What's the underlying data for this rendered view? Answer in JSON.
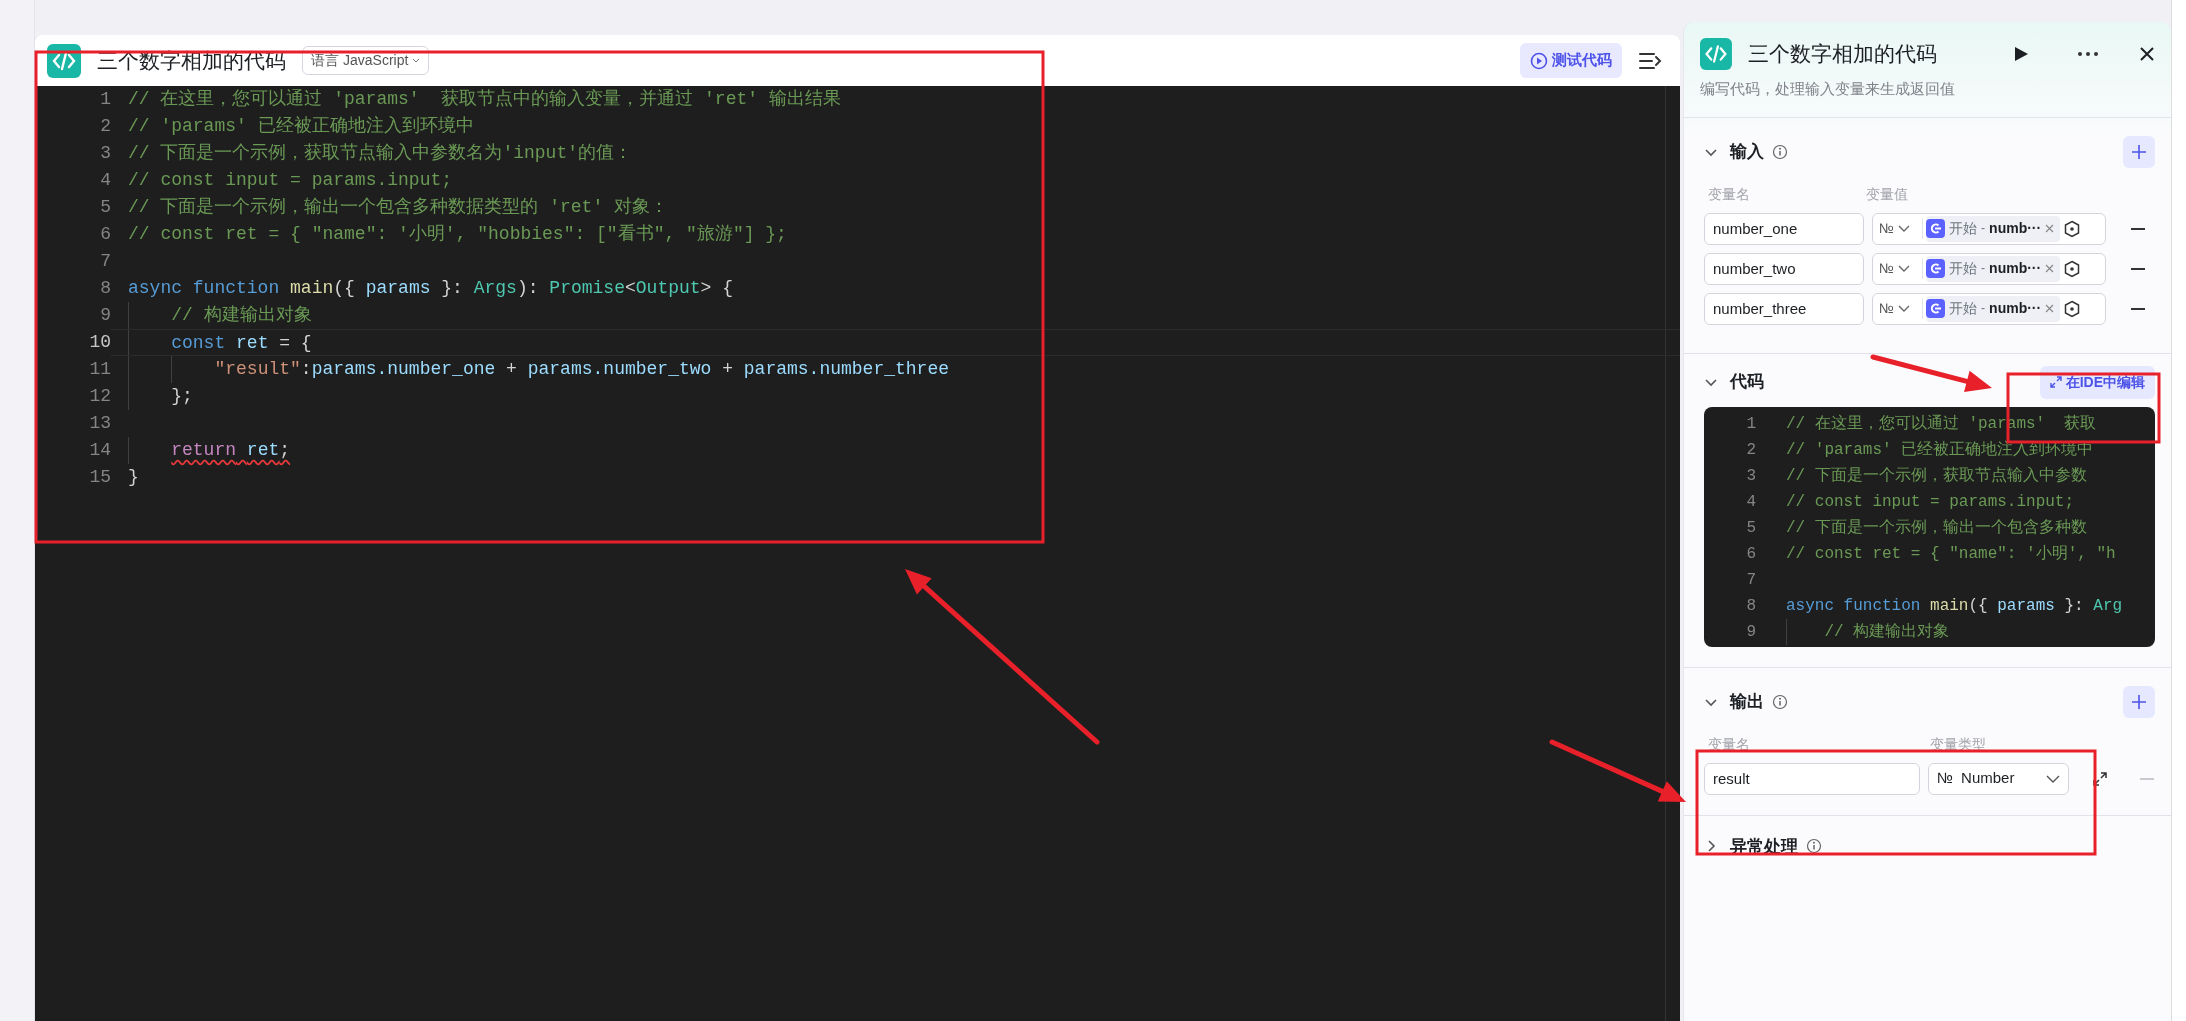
{
  "editor": {
    "title": "三个数字相加的代码",
    "language_label": "语言",
    "language": "JavaScript",
    "test_button": "测试代码",
    "lines": [
      {
        "number": "1",
        "current": false,
        "tokens": [
          {
            "kind": "comment",
            "text": "// 在这里，您可以通过 'params'  获取节点中的输入变量，并通过 'ret' 输出结果"
          }
        ]
      },
      {
        "number": "2",
        "current": false,
        "tokens": [
          {
            "kind": "comment",
            "text": "// 'params' 已经被正确地注入到环境中"
          }
        ]
      },
      {
        "number": "3",
        "current": false,
        "tokens": [
          {
            "kind": "comment",
            "text": "// 下面是一个示例，获取节点输入中参数名为'input'的值："
          }
        ]
      },
      {
        "number": "4",
        "current": false,
        "tokens": [
          {
            "kind": "comment",
            "text": "// const input = params.input;"
          }
        ]
      },
      {
        "number": "5",
        "current": false,
        "tokens": [
          {
            "kind": "comment",
            "text": "// 下面是一个示例，输出一个包含多种数据类型的 'ret' 对象："
          }
        ]
      },
      {
        "number": "6",
        "current": false,
        "tokens": [
          {
            "kind": "comment",
            "text": "// const ret = { \"name\": '小明', \"hobbies\": [\"看书\", \"旅游\"] };"
          }
        ]
      },
      {
        "number": "7",
        "current": false
      },
      {
        "number": "8",
        "current": false,
        "tokens": [
          {
            "kind": "keyword",
            "text": "async function "
          },
          {
            "kind": "function",
            "text": "main"
          },
          {
            "kind": "plain",
            "text": "({ "
          },
          {
            "kind": "variable",
            "text": "params"
          },
          {
            "kind": "plain",
            "text": " }: "
          },
          {
            "kind": "type",
            "text": "Args"
          },
          {
            "kind": "plain",
            "text": "): "
          },
          {
            "kind": "type",
            "text": "Promise"
          },
          {
            "kind": "plain",
            "text": "<"
          },
          {
            "kind": "type",
            "text": "Output"
          },
          {
            "kind": "plain",
            "text": "> {"
          }
        ]
      },
      {
        "number": "9",
        "current": false,
        "tokens": [
          {
            "kind": "comment",
            "text": "    // 构建输出对象"
          }
        ]
      },
      {
        "number": "10",
        "current": true,
        "tokens": [
          {
            "kind": "keyword",
            "text": "    const "
          },
          {
            "kind": "variable",
            "text": "ret"
          },
          {
            "kind": "plain",
            "text": " = {"
          }
        ]
      },
      {
        "number": "11",
        "current": false,
        "tokens": [
          {
            "kind": "string",
            "text": "        \"result\""
          },
          {
            "kind": "plain",
            "text": ":"
          },
          {
            "kind": "variable",
            "text": "params.number_one"
          },
          {
            "kind": "plain",
            "text": " + "
          },
          {
            "kind": "variable",
            "text": "params.number_two"
          },
          {
            "kind": "plain",
            "text": " + "
          },
          {
            "kind": "variable",
            "text": "params.number_three"
          }
        ]
      },
      {
        "number": "12",
        "current": false,
        "tokens": [
          {
            "kind": "plain",
            "text": "    };"
          }
        ]
      },
      {
        "number": "13",
        "current": false
      },
      {
        "number": "14",
        "current": false,
        "squiggle": true,
        "tokens": [
          {
            "kind": "control",
            "text": "    return "
          },
          {
            "kind": "variable",
            "text": "ret"
          },
          {
            "kind": "plain",
            "text": ";"
          }
        ]
      },
      {
        "number": "15",
        "current": false,
        "tokens": [
          {
            "kind": "plain",
            "text": "}"
          }
        ]
      }
    ]
  },
  "panel": {
    "title": "三个数字相加的代码",
    "subtitle": "编写代码，处理输入变量来生成返回值",
    "inputs": {
      "title": "输入",
      "expanded": true,
      "columns": [
        "变量名",
        "变量值"
      ],
      "rows": [
        {
          "name": "number_one",
          "type_icon": "№",
          "source": "开始",
          "separator": "-",
          "ref": "numb···",
          "remove_disabled": false
        },
        {
          "name": "number_two",
          "type_icon": "№",
          "source": "开始",
          "separator": "-",
          "ref": "numb···",
          "remove_disabled": false
        },
        {
          "name": "number_three",
          "type_icon": "№",
          "source": "开始",
          "separator": "-",
          "ref": "numb···",
          "remove_disabled": false
        }
      ]
    },
    "code": {
      "title": "代码",
      "expanded": true,
      "ide_button": "在IDE中编辑",
      "lines": [
        {
          "number": "1",
          "tokens": [
            {
              "kind": "comment",
              "text": "// 在这里，您可以通过 'params'  获取"
            }
          ]
        },
        {
          "number": "2",
          "tokens": [
            {
              "kind": "comment",
              "text": "// 'params' 已经被正确地注入到环境中"
            }
          ]
        },
        {
          "number": "3",
          "tokens": [
            {
              "kind": "comment",
              "text": "// 下面是一个示例，获取节点输入中参数"
            }
          ]
        },
        {
          "number": "4",
          "tokens": [
            {
              "kind": "comment",
              "text": "// const input = params.input;"
            }
          ]
        },
        {
          "number": "5",
          "tokens": [
            {
              "kind": "comment",
              "text": "// 下面是一个示例，输出一个包含多种数"
            }
          ]
        },
        {
          "number": "6",
          "tokens": [
            {
              "kind": "comment",
              "text": "// const ret = { \"name\": '小明', \"h"
            }
          ]
        },
        {
          "number": "7"
        },
        {
          "number": "8",
          "tokens": [
            {
              "kind": "keyword",
              "text": "async function "
            },
            {
              "kind": "function",
              "text": "main"
            },
            {
              "kind": "plain",
              "text": "({ "
            },
            {
              "kind": "variable",
              "text": "params"
            },
            {
              "kind": "plain",
              "text": " }: "
            },
            {
              "kind": "type",
              "text": "Arg"
            }
          ]
        },
        {
          "number": "9",
          "tokens": [
            {
              "kind": "comment",
              "text": "    // 构建输出对象"
            }
          ]
        }
      ]
    },
    "outputs": {
      "title": "输出",
      "expanded": true,
      "columns": [
        "变量名",
        "变量类型"
      ],
      "rows": [
        {
          "name": "result",
          "type_icon": "№",
          "type": "Number",
          "remove_disabled": true
        }
      ]
    },
    "error_handling": {
      "title": "异常处理",
      "expanded": false
    }
  },
  "annotations": [
    {
      "kind": "box"
    },
    {
      "kind": "box"
    },
    {
      "kind": "box"
    },
    {
      "kind": "arrow"
    },
    {
      "kind": "arrow"
    },
    {
      "kind": "arrow"
    }
  ]
}
